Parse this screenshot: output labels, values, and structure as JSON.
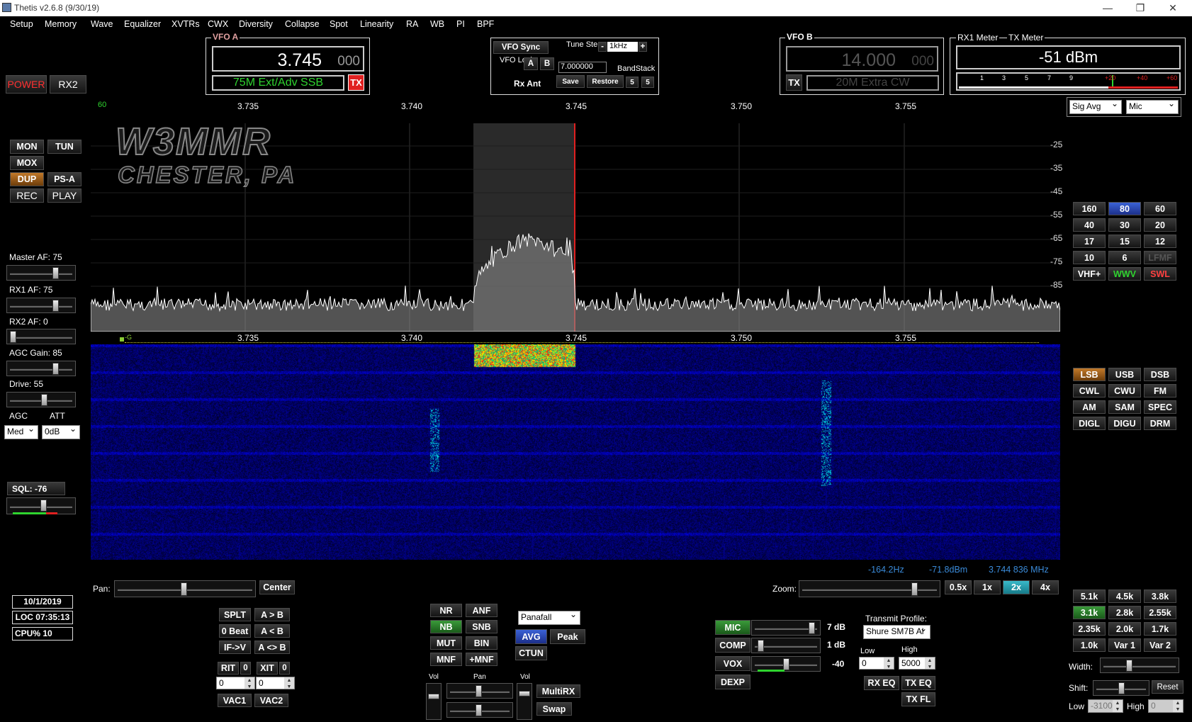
{
  "window": {
    "title": "Thetis v2.6.8 (9/30/19)"
  },
  "menu": [
    "Setup",
    "Memory",
    "Wave",
    "Equalizer",
    "XVTRs",
    "CWX",
    "Diversity",
    "Collapse",
    "Spot",
    "Linearity",
    "RA",
    "WB",
    "PI",
    "BPF"
  ],
  "vfoA": {
    "label": "VFO A",
    "freq_main": "3.745",
    "freq_sub": "000",
    "mode": "75M Ext/Adv SSB",
    "tx": "TX"
  },
  "vfoB": {
    "label": "VFO B",
    "freq_main": "14.000",
    "freq_sub": "000",
    "mode": "20M Extra CW",
    "tx": "TX"
  },
  "vfoSync": {
    "sync": "VFO Sync",
    "lock": "VFO Lock:",
    "a": "A",
    "b": "B",
    "tune_step": "Tune Step:",
    "step_value": "1kHz",
    "minus": "-",
    "plus": "+",
    "bandstack_freq": "7.000000",
    "bandstack": "BandStack",
    "rx_ant": "Rx Ant",
    "save": "Save",
    "restore": "Restore",
    "five1": "5",
    "five2": "5"
  },
  "meter": {
    "rx1": "RX1 Meter",
    "tx": "TX Meter",
    "reading": "-51 dBm",
    "scale": [
      "1",
      "3",
      "5",
      "7",
      "9",
      "+20",
      "+40",
      "+60"
    ],
    "sel1": "Sig Avg",
    "sel2": "Mic"
  },
  "power": {
    "power": "POWER",
    "rx2": "RX2"
  },
  "left_buttons": {
    "mon": "MON",
    "tun": "TUN",
    "mox": "MOX",
    "dup": "DUP",
    "psa": "PS-A",
    "rec": "REC",
    "play": "PLAY"
  },
  "sliders": {
    "master": "Master AF:  75",
    "rx1": "RX1 AF:  75",
    "rx2": "RX2 AF:  0",
    "agc_gain": "AGC Gain:  85",
    "drive": "Drive:  55",
    "agc": "AGC",
    "att": "ATT",
    "agc_val": "Med",
    "att_val": "0dB",
    "sql": "SQL: -76"
  },
  "status": {
    "date": "10/1/2019",
    "loc": "LOC 07:35:13",
    "cpu": "CPU%  10"
  },
  "pan": {
    "top_left_num": "60",
    "freqs": [
      "3.735",
      "3.740",
      "3.745",
      "3.750",
      "3.755"
    ],
    "dbs": [
      "-25",
      "-35",
      "-45",
      "-55",
      "-65",
      "-75",
      "-85"
    ],
    "logo1": "W3MMR",
    "logo2": "CHESTER, PA"
  },
  "wf": {
    "marker": "-G",
    "readout1": "-164.2Hz",
    "readout2": "-71.8dBm",
    "readout3": "3.744 836 MHz"
  },
  "bands": [
    "160",
    "80",
    "60",
    "40",
    "30",
    "20",
    "17",
    "15",
    "12",
    "10",
    "6",
    "LFMF",
    "VHF+",
    "WWV",
    "SWL"
  ],
  "modes": [
    "LSB",
    "USB",
    "DSB",
    "CWL",
    "CWU",
    "FM",
    "AM",
    "SAM",
    "SPEC",
    "DIGL",
    "DIGU",
    "DRM"
  ],
  "filters": [
    "5.1k",
    "4.5k",
    "3.8k",
    "3.1k",
    "2.8k",
    "2.55k",
    "2.35k",
    "2.0k",
    "1.7k",
    "1.0k",
    "Var 1",
    "Var 2"
  ],
  "filter_ctrl": {
    "width": "Width:",
    "shift": "Shift:",
    "reset": "Reset",
    "low": "Low",
    "low_val": "-3100",
    "high": "High",
    "high_val": "0"
  },
  "pan_ctrl": {
    "pan": "Pan:",
    "center": "Center",
    "zoom": "Zoom:",
    "z05": "0.5x",
    "z1": "1x",
    "z2": "2x",
    "z4": "4x"
  },
  "split": {
    "splt": "SPLT",
    "atob": "A > B",
    "zbeat": "0 Beat",
    "altb": "A < B",
    "ifv": "IF->V",
    "aswap": "A <> B",
    "rit": "RIT",
    "rit_v": "0",
    "xit": "XIT",
    "xit_v": "0",
    "rit_spin": "0",
    "xit_spin": "0",
    "vac1": "VAC1",
    "vac2": "VAC2"
  },
  "dsp": {
    "nr": "NR",
    "anf": "ANF",
    "nb": "NB",
    "snb": "SNB",
    "mut": "MUT",
    "bin": "BIN",
    "mnf": "MNF",
    "pmnf": "+MNF",
    "display": "Panafall",
    "avg": "AVG",
    "peak": "Peak",
    "ctun": "CTUN",
    "vol": "Vol",
    "pan": "Pan",
    "vol2": "Vol",
    "multirx": "MultiRX",
    "swap": "Swap"
  },
  "tx": {
    "mic": "MIC",
    "mic_db": "7 dB",
    "comp": "COMP",
    "comp_db": "1 dB",
    "vox": "VOX",
    "vox_db": "-40",
    "dexp": "DEXP",
    "profile_lbl": "Transmit Profile:",
    "profile": "Shure SM7B Al",
    "low": "Low",
    "high": "High",
    "low_v": "0",
    "high_v": "5000",
    "rxeq": "RX EQ",
    "txeq": "TX EQ",
    "txfl": "TX FL"
  }
}
